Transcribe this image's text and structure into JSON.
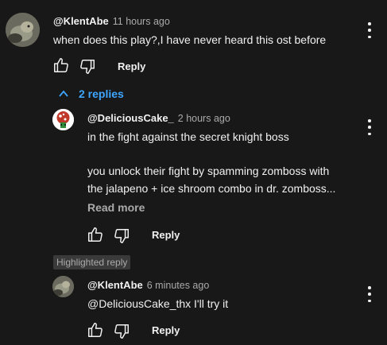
{
  "comment": {
    "author": "@KlentAbe",
    "time": "11 hours ago",
    "text": "when does this play?,I have never heard this ost before",
    "like_icon": "thumb-up-icon",
    "dislike_icon": "thumb-down-icon",
    "reply_label": "Reply",
    "menu_icon": "more-vertical-icon"
  },
  "replies_toggle": {
    "label": "2 replies",
    "icon": "chevron-up-icon",
    "color": "#3ea6ff"
  },
  "replies": [
    {
      "author": "@DeliciousCake_",
      "time": "2 hours ago",
      "lines": [
        "in the fight against the secret knight boss",
        "you unlock their fight by spamming zomboss with",
        "the jalapeno + ice shroom combo in dr. zomboss..."
      ],
      "read_more": "Read more",
      "reply_label": "Reply"
    },
    {
      "badge": "Highlighted reply",
      "author": "@KlentAbe",
      "time": "6 minutes ago",
      "text": "@DeliciousCake_thx I'll try it",
      "reply_label": "Reply"
    }
  ],
  "colors": {
    "background": "#181818",
    "text": "#f1f1f1",
    "secondary": "#aaaaaa",
    "link": "#3ea6ff"
  }
}
